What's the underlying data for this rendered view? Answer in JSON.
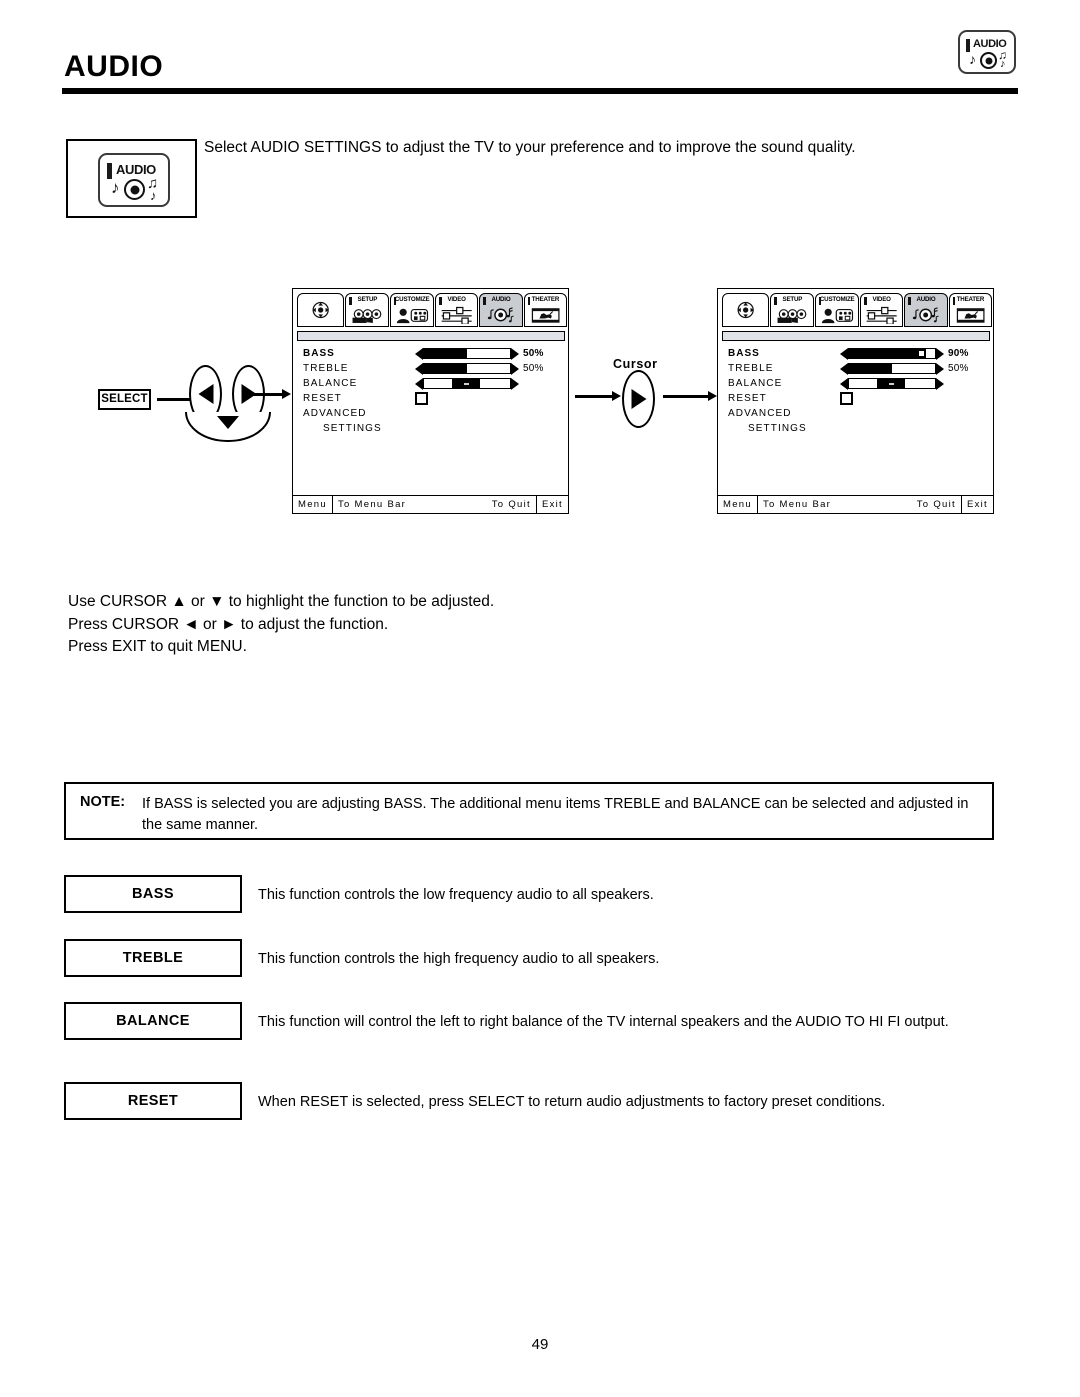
{
  "page": {
    "title": "AUDIO",
    "number": "49"
  },
  "header": {
    "corner_icon": {
      "name": "audio-button-icon",
      "label": "AUDIO"
    }
  },
  "intro": {
    "icon_label": "AUDIO",
    "text": "Select AUDIO SETTINGS to adjust the TV to your preference and to improve the sound quality."
  },
  "flow": {
    "select_button": "SELECT",
    "cursor_label": "Cursor"
  },
  "osd_tabs": [
    {
      "id": "home",
      "label": "",
      "icon": "dpad-icon",
      "active": false
    },
    {
      "id": "setup",
      "label": "SETUP",
      "icon": "camcorder-icon",
      "active": false
    },
    {
      "id": "customize",
      "label": "CUSTOMIZE",
      "icon": "person-icon",
      "active": false
    },
    {
      "id": "video",
      "label": "VIDEO",
      "icon": "sliders-icon",
      "active": false
    },
    {
      "id": "audio",
      "label": "AUDIO",
      "icon": "audio-note-icon",
      "active": true
    },
    {
      "id": "theater",
      "label": "THEATER",
      "icon": "film-icon",
      "active": false
    }
  ],
  "osd_footer": {
    "menu": "Menu",
    "to_menu_bar": "To Menu Bar",
    "to_quit": "To Quit",
    "exit": "Exit"
  },
  "menu_screen_1": {
    "rows": [
      {
        "name": "BASS",
        "type": "slider",
        "value": "50%",
        "fill": 50,
        "selected": true
      },
      {
        "name": "TREBLE",
        "type": "slider",
        "value": "50%",
        "fill": 50,
        "selected": false
      },
      {
        "name": "BALANCE",
        "type": "balance",
        "value": "",
        "fill": 50,
        "selected": false
      },
      {
        "name": "RESET",
        "type": "checkbox",
        "value": "",
        "fill": 0,
        "selected": false
      },
      {
        "name": "ADVANCED",
        "type": "text",
        "value": "",
        "fill": 0,
        "selected": false
      },
      {
        "name": "SETTINGS",
        "type": "subtext",
        "value": "",
        "fill": 0,
        "selected": false
      }
    ]
  },
  "menu_screen_2": {
    "rows": [
      {
        "name": "BASS",
        "type": "slider",
        "value": "90%",
        "fill": 90,
        "selected": true
      },
      {
        "name": "TREBLE",
        "type": "slider",
        "value": "50%",
        "fill": 50,
        "selected": false
      },
      {
        "name": "BALANCE",
        "type": "balance",
        "value": "",
        "fill": 50,
        "selected": false
      },
      {
        "name": "RESET",
        "type": "checkbox",
        "value": "",
        "fill": 0,
        "selected": false
      },
      {
        "name": "ADVANCED",
        "type": "text",
        "value": "",
        "fill": 0,
        "selected": false
      },
      {
        "name": "SETTINGS",
        "type": "subtext",
        "value": "",
        "fill": 0,
        "selected": false
      }
    ]
  },
  "usage": {
    "line1": "Use CURSOR ▲ or ▼ to highlight the function to be adjusted.",
    "line2": "Press CURSOR ◄ or ► to adjust the function.",
    "line3": "Press EXIT to quit MENU."
  },
  "note": {
    "label": "NOTE:",
    "text": "If BASS is selected you are adjusting BASS.  The additional menu items TREBLE and BALANCE can be selected and adjusted in the same manner."
  },
  "definitions": [
    {
      "term": "BASS",
      "text": "This function controls the low frequency audio to all speakers."
    },
    {
      "term": "TREBLE",
      "text": "This function controls the high frequency audio to all speakers."
    },
    {
      "term": "BALANCE",
      "text": "This function will control the left to right balance of the TV internal speakers and the AUDIO TO HI FI output."
    },
    {
      "term": "RESET",
      "text": "When RESET is selected, press SELECT to return audio adjustments to factory preset conditions."
    }
  ]
}
